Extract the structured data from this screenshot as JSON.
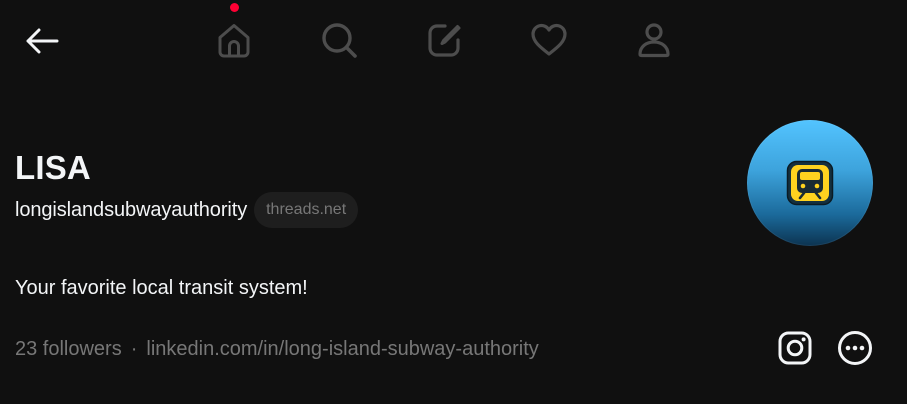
{
  "nav": {
    "items": [
      {
        "name": "home",
        "icon": "home-icon"
      },
      {
        "name": "search",
        "icon": "search-icon"
      },
      {
        "name": "create",
        "icon": "compose-icon"
      },
      {
        "name": "activity",
        "icon": "heart-icon"
      },
      {
        "name": "profile",
        "icon": "person-icon"
      }
    ],
    "notification_dot_color": "#ff0034",
    "icon_color": "#4d4d4d"
  },
  "profile": {
    "display_name": "LISA",
    "username": "longislandsubwayauthority",
    "domain_badge": "threads.net",
    "bio": "Your favorite local transit system!",
    "followers": "23 followers",
    "separator": "·",
    "link": "linkedin.com/in/long-island-subway-authority",
    "avatar_icon": "train-icon",
    "avatar_colors": {
      "top": "#53c4ff",
      "bottom": "#0c3350",
      "badge": "#ffd21f"
    }
  },
  "actions": {
    "instagram_icon": "instagram-icon",
    "more_icon": "more-icon"
  },
  "colors": {
    "background": "#101010",
    "primary_text": "#f3f5f7",
    "secondary_text": "#777777",
    "pill_background": "#1e1e1e"
  }
}
